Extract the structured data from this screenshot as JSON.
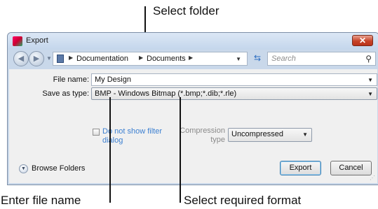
{
  "callouts": {
    "select_folder": "Select folder",
    "enter_file_name": "Enter file name",
    "select_format": "Select required format"
  },
  "window": {
    "title": "Export",
    "close": "✕"
  },
  "navigation": {
    "back": "◀",
    "forward": "▶",
    "breadcrumb": [
      "Documentation",
      "Documents"
    ],
    "search_placeholder": "Search"
  },
  "form": {
    "file_name_label": "File name:",
    "file_name_value": "My Design",
    "save_as_type_label": "Save as type:",
    "save_as_type_value": "BMP - Windows Bitmap (*.bmp;*.dib;*.rle)",
    "do_not_show_filter_dialog": "Do not show filter dialog",
    "compression_type_label": "Compression type",
    "compression_type_value": "Uncompressed"
  },
  "footer": {
    "browse_folders": "Browse Folders",
    "export": "Export",
    "cancel": "Cancel"
  }
}
